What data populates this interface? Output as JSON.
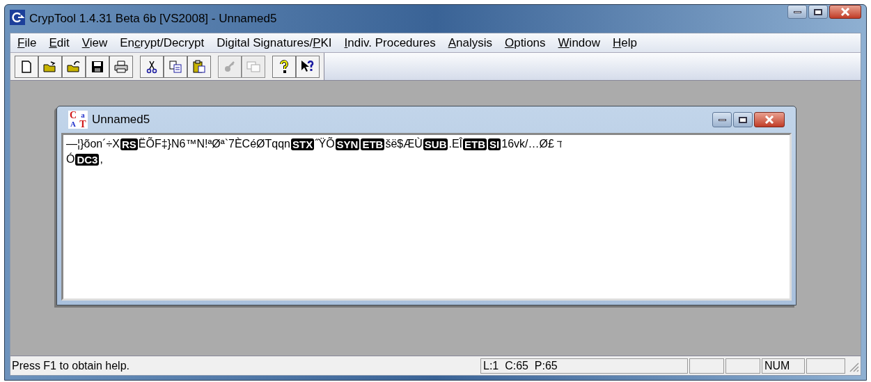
{
  "window": {
    "title": "CrypTool 1.4.31 Beta 6b [VS2008] - Unnamed5"
  },
  "menu": [
    {
      "key": "F",
      "after": "ile"
    },
    {
      "key": "E",
      "after": "dit"
    },
    {
      "key": "V",
      "after": "iew"
    },
    {
      "before": "En",
      "key": "c",
      "after": "rypt/Decrypt"
    },
    {
      "before": "Digital Signatures/",
      "key": "P",
      "after": "KI"
    },
    {
      "key": "I",
      "after": "ndiv. Procedures"
    },
    {
      "key": "A",
      "after": "nalysis"
    },
    {
      "key": "O",
      "after": "ptions"
    },
    {
      "key": "W",
      "after": "indow"
    },
    {
      "key": "H",
      "after": "elp"
    }
  ],
  "toolbar": [
    [
      {
        "kind": "new",
        "disabled": false
      },
      {
        "kind": "open",
        "disabled": false
      },
      {
        "kind": "open-folder",
        "disabled": false
      },
      {
        "kind": "save",
        "disabled": false
      },
      {
        "kind": "print",
        "disabled": false
      }
    ],
    [
      {
        "kind": "cut",
        "disabled": false
      },
      {
        "kind": "copy",
        "disabled": false
      },
      {
        "kind": "paste",
        "disabled": false
      }
    ],
    [
      {
        "kind": "key",
        "disabled": true
      },
      {
        "kind": "windows",
        "disabled": true
      }
    ],
    [
      {
        "kind": "help",
        "disabled": false
      },
      {
        "kind": "context-help",
        "disabled": false
      }
    ]
  ],
  "document": {
    "title": "Unnamed5",
    "icon_letters": [
      "C",
      "a",
      "A",
      "T"
    ],
    "lines": [
      [
        {
          "kind": "text",
          "text": "—¦}õon´÷X"
        },
        {
          "kind": "control",
          "text": "RS"
        },
        {
          "kind": "text",
          "text": "ËÕF‡}N6™N!ªØª`7ÈCéØTqqn"
        },
        {
          "kind": "control",
          "text": "STX"
        },
        {
          "kind": "text",
          "text": "˝ŸÕ"
        },
        {
          "kind": "control",
          "text": "SYN"
        },
        {
          "kind": "control",
          "text": "ETB"
        },
        {
          "kind": "text",
          "text": "šë$ÆÙ"
        },
        {
          "kind": "control",
          "text": "SUB"
        },
        {
          "kind": "text",
          "text": ".EÎ"
        },
        {
          "kind": "control",
          "text": "ETB"
        },
        {
          "kind": "control",
          "text": "SI"
        },
        {
          "kind": "text",
          "text": "16vk/…Ø£ ℸ"
        }
      ],
      [
        {
          "kind": "text",
          "text": "Ó"
        },
        {
          "kind": "control",
          "text": "DC3"
        },
        {
          "kind": "text",
          "text": ","
        }
      ]
    ]
  },
  "status_bar": {
    "message": "Press F1 to obtain help.",
    "position": "L:1  C:65  P:65",
    "num": "NUM"
  }
}
